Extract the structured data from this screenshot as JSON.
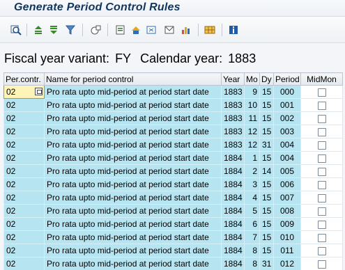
{
  "window": {
    "title": "Generate Period Control Rules"
  },
  "toolbar": {
    "buttons": [
      "details-icon",
      "sort-ascending-icon",
      "sort-descending-icon",
      "filter-icon",
      "total-icon",
      "export-icon",
      "print-icon",
      "spreadsheet-icon",
      "send-icon",
      "chart-icon",
      "layout-icon",
      "info-icon"
    ]
  },
  "header": {
    "fy_label": "Fiscal year variant:",
    "fy_value": "FY",
    "cal_label": "Calendar year:",
    "cal_value": "1883"
  },
  "table": {
    "columns": [
      "Per.contr.",
      "Name for period control",
      "Year",
      "Mo",
      "Dy",
      "Period",
      "MidMon"
    ],
    "rows": [
      {
        "per": "02",
        "name": "Pro rata upto mid-period at period start date",
        "year": "1883",
        "mo": "9",
        "dy": "15",
        "period": "000"
      },
      {
        "per": "02",
        "name": "Pro rata upto mid-period at period start date",
        "year": "1883",
        "mo": "10",
        "dy": "15",
        "period": "001"
      },
      {
        "per": "02",
        "name": "Pro rata upto mid-period at period start date",
        "year": "1883",
        "mo": "11",
        "dy": "15",
        "period": "002"
      },
      {
        "per": "02",
        "name": "Pro rata upto mid-period at period start date",
        "year": "1883",
        "mo": "12",
        "dy": "15",
        "period": "003"
      },
      {
        "per": "02",
        "name": "Pro rata upto mid-period at period start date",
        "year": "1883",
        "mo": "12",
        "dy": "31",
        "period": "004"
      },
      {
        "per": "02",
        "name": "Pro rata upto mid-period at period start date",
        "year": "1884",
        "mo": "1",
        "dy": "15",
        "period": "004"
      },
      {
        "per": "02",
        "name": "Pro rata upto mid-period at period start date",
        "year": "1884",
        "mo": "2",
        "dy": "14",
        "period": "005"
      },
      {
        "per": "02",
        "name": "Pro rata upto mid-period at period start date",
        "year": "1884",
        "mo": "3",
        "dy": "15",
        "period": "006"
      },
      {
        "per": "02",
        "name": "Pro rata upto mid-period at period start date",
        "year": "1884",
        "mo": "4",
        "dy": "15",
        "period": "007"
      },
      {
        "per": "02",
        "name": "Pro rata upto mid-period at period start date",
        "year": "1884",
        "mo": "5",
        "dy": "15",
        "period": "008"
      },
      {
        "per": "02",
        "name": "Pro rata upto mid-period at period start date",
        "year": "1884",
        "mo": "6",
        "dy": "15",
        "period": "009"
      },
      {
        "per": "02",
        "name": "Pro rata upto mid-period at period start date",
        "year": "1884",
        "mo": "7",
        "dy": "15",
        "period": "010"
      },
      {
        "per": "02",
        "name": "Pro rata upto mid-period at period start date",
        "year": "1884",
        "mo": "8",
        "dy": "15",
        "period": "011"
      },
      {
        "per": "02",
        "name": "Pro rata upto mid-period at period start date",
        "year": "1884",
        "mo": "8",
        "dy": "31",
        "period": "012"
      }
    ]
  }
}
